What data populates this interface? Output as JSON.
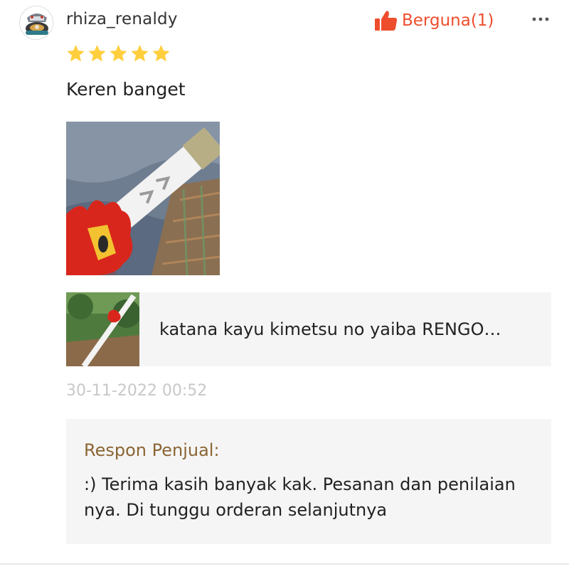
{
  "review": {
    "username": "rhiza_renaldy",
    "helpful_label": "Berguna(1)",
    "more_label": "⋯",
    "rating": 5,
    "comment": "Keren banget",
    "timestamp": "30-11-2022 00:52"
  },
  "product": {
    "name": "katana kayu kimetsu no yaiba RENGO…"
  },
  "seller_response": {
    "title": "Respon Penjual:",
    "text": ":) Terima kasih banyak kak. Pesanan dan penilaian nya. Di tunggu orderan selanjutnya"
  },
  "colors": {
    "accent": "#ee4d2d",
    "star": "#ffce3d",
    "seller_title": "#8b6534",
    "timestamp": "#c8c8c8",
    "panel_background": "#f5f5f5"
  },
  "icons": {
    "helpful": "thumbs-up-icon",
    "more": "more-dots-icon",
    "rating": "star-icon"
  }
}
